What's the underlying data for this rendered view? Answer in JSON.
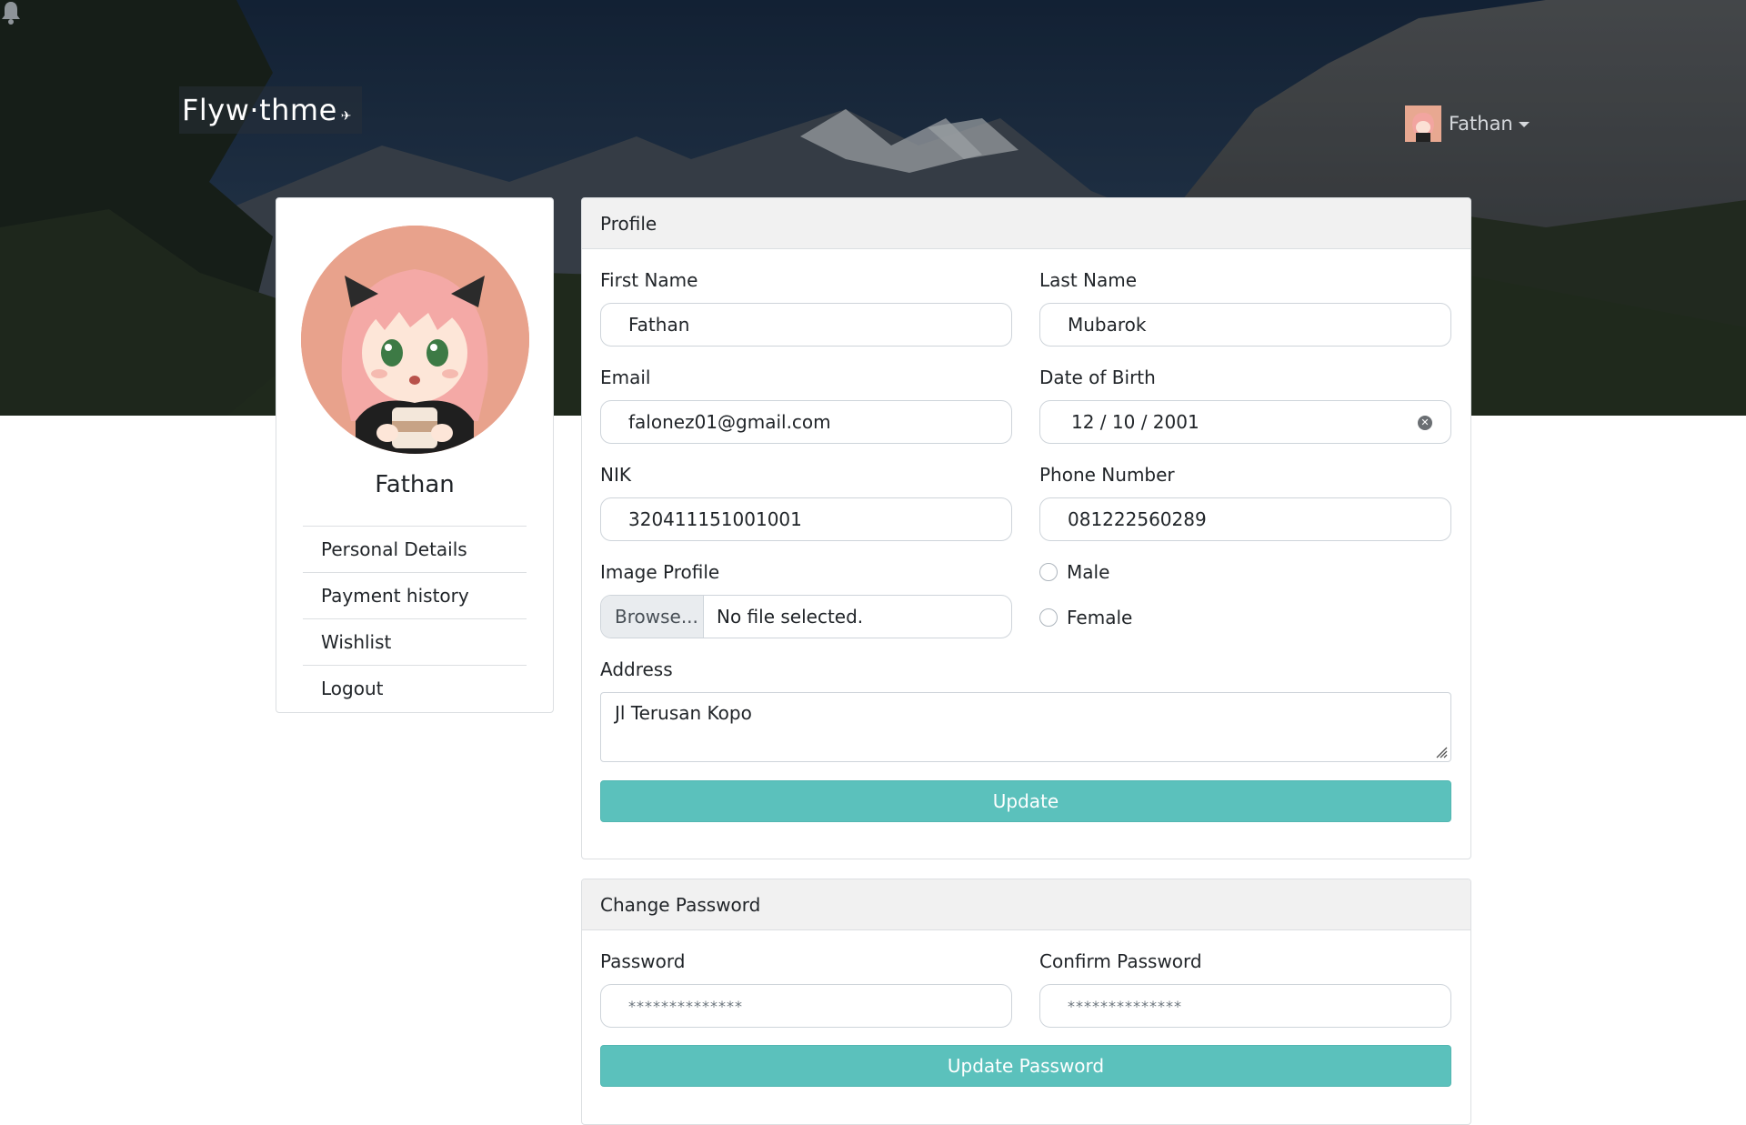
{
  "header": {
    "logo_text": "Flyw·thme",
    "user_name": "Fathan"
  },
  "sidebar": {
    "name": "Fathan",
    "items": [
      {
        "label": "Personal Details"
      },
      {
        "label": "Payment history"
      },
      {
        "label": "Wishlist"
      },
      {
        "label": "Logout"
      }
    ]
  },
  "profile": {
    "title": "Profile",
    "first_name_label": "First Name",
    "first_name": "Fathan",
    "last_name_label": "Last Name",
    "last_name": "Mubarok",
    "email_label": "Email",
    "email": "falonez01@gmail.com",
    "dob_label": "Date of Birth",
    "dob": "12 / 10 / 2001",
    "nik_label": "NIK",
    "nik": "320411151001001",
    "phone_label": "Phone Number",
    "phone": "081222560289",
    "image_label": "Image Profile",
    "browse_label": "Browse...",
    "file_status": "No file selected.",
    "gender_options": [
      "Male",
      "Female"
    ],
    "address_label": "Address",
    "address": "Jl Terusan Kopo",
    "update_label": "Update"
  },
  "password": {
    "title": "Change Password",
    "password_label": "Password",
    "password_mask": "**************",
    "confirm_label": "Confirm Password",
    "confirm_mask": "**************",
    "update_label": "Update Password"
  },
  "colors": {
    "accent": "#5bc1bc",
    "panel_header": "#f1f1f1",
    "border": "#dcdfe2"
  }
}
